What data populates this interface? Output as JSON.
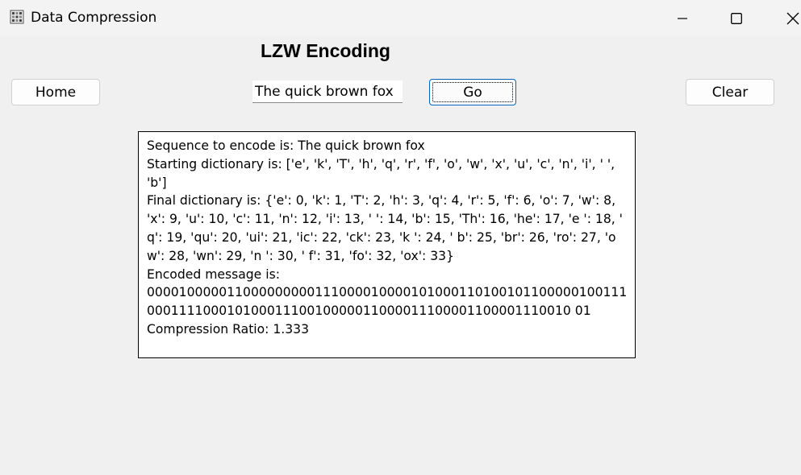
{
  "window": {
    "title": "Data Compression",
    "icon": "data-compression-app-icon"
  },
  "heading": "LZW Encoding",
  "buttons": {
    "home": "Home",
    "go": "Go",
    "clear": "Clear"
  },
  "input": {
    "value": "The quick brown fox"
  },
  "output": {
    "sequence": "Sequence to encode is: The quick brown fox",
    "starting_dictionary": "Starting dictionary is: ['e', 'k', 'T', 'h', 'q', 'r', 'f', 'o', 'w', 'x', 'u', 'c', 'n', 'i', ' ', 'b']",
    "final_dictionary": "Final dictionary is: {'e': 0, 'k': 1, 'T': 2, 'h': 3, 'q': 4, 'r': 5, 'f': 6, 'o': 7, 'w': 8, 'x': 9, 'u': 10, 'c': 11, 'n': 12, 'i': 13, ' ': 14, 'b': 15, 'Th': 16, 'he': 17, 'e ': 18, ' q': 19, 'qu': 20, 'ui': 21, 'ic': 22, 'ck': 23, 'k ': 24, ' b': 25, 'br': 26, 'ro': 27, 'ow': 28, 'wn': 29, 'n ': 30, ' f': 31, 'fo': 32, 'ox': 33}",
    "encoded_label": "Encoded message is:",
    "encoded_message": "00001000001100000000011100001000010100011010010110000010011100011110001010001110010000011000011100001100001110010 01",
    "compression_ratio": "Compression Ratio: 1.333"
  }
}
